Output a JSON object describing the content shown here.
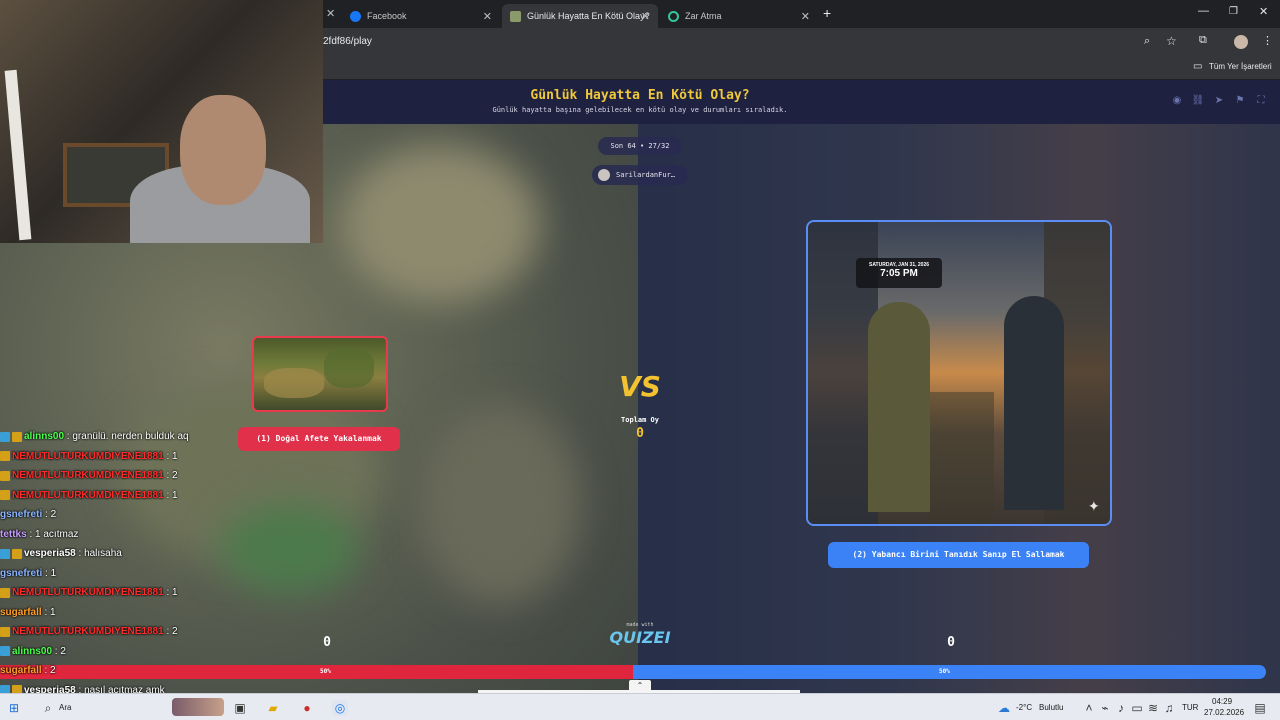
{
  "browser": {
    "tabs": [
      {
        "label": "Facebook",
        "active": false
      },
      {
        "label": "Günlük Hayatta En Kötü Olay?",
        "active": true
      },
      {
        "label": "Zar Atma",
        "active": false
      }
    ],
    "url": "2fdf86/play",
    "bookmarks_label": "Tüm Yer İşaretleri"
  },
  "quiz": {
    "title": "Günlük Hayatta En Kötü Olay?",
    "subtitle": "Günlük hayatta başına gelebilecek en kötü olay ve durumları sıraladık.",
    "round": "Son 64 • 27/32",
    "user": "SarilardanFur…",
    "vs": "VS",
    "total_label": "Toplam Oy",
    "total_value": "0",
    "left": {
      "label": "(1) Doğal Afete Yakalanmak",
      "count": "0",
      "percent_label": "50%",
      "share": 0.5,
      "color": "#e0263d"
    },
    "right": {
      "label": "(2) Yabancı Birini Tanıdık Sanıp El Sallamak",
      "count": "0",
      "percent_label": "50%",
      "share": 0.5,
      "color": "#3b82f6",
      "photo_clock_date": "SATURDAY, JAN 31, 2026",
      "photo_clock_time": "7:05 PM"
    },
    "made_with": "made with",
    "brand": "QUIZEI"
  },
  "chat": [
    {
      "user": "alinns00",
      "color": "#4cff4c",
      "msg": "granülü. nerden bulduk aq",
      "badges": [
        "blue",
        "gold"
      ]
    },
    {
      "user": "NEMUTLUTURKUMDIYENE1881",
      "color": "#ff2a2a",
      "msg": "1",
      "badges": [
        "gold"
      ]
    },
    {
      "user": "NEMUTLUTURKUMDIYENE1881",
      "color": "#ff2a2a",
      "msg": "2",
      "badges": [
        "gold"
      ]
    },
    {
      "user": "NEMUTLUTURKUMDIYENE1881",
      "color": "#ff2a2a",
      "msg": "1",
      "badges": [
        "gold"
      ]
    },
    {
      "user": "gsnefreti",
      "color": "#8ab4ff",
      "msg": "2",
      "badges": []
    },
    {
      "user": "tettks",
      "color": "#c79bff",
      "msg": "1 acıtmaz",
      "badges": []
    },
    {
      "user": "vesperia58",
      "color": "#ffffff",
      "msg": "halısaha",
      "badges": [
        "blue",
        "gold"
      ]
    },
    {
      "user": "gsnefreti",
      "color": "#8ab4ff",
      "msg": "1",
      "badges": []
    },
    {
      "user": "NEMUTLUTURKUMDIYENE1881",
      "color": "#ff2a2a",
      "msg": "1",
      "badges": [
        "gold"
      ]
    },
    {
      "user": "sugarfall",
      "color": "#ff9d2a",
      "msg": "1",
      "badges": []
    },
    {
      "user": "NEMUTLUTURKUMDIYENE1881",
      "color": "#ff2a2a",
      "msg": "2",
      "badges": [
        "gold"
      ]
    },
    {
      "user": "alinns00",
      "color": "#4cff4c",
      "msg": "2",
      "badges": [
        "blue"
      ]
    },
    {
      "user": "sugarfall",
      "color": "#ff9d2a",
      "msg": "2",
      "badges": []
    },
    {
      "user": "vesperia58",
      "color": "#ffffff",
      "msg": "nasıl acıtmaz amk",
      "badges": [
        "blue",
        "gold"
      ]
    }
  ],
  "taskbar": {
    "search": "Ara",
    "weather": "-2°C",
    "weather_desc": "Bulutlu",
    "lang": "TUR",
    "time": "04:29",
    "date": "27.02.2026"
  }
}
